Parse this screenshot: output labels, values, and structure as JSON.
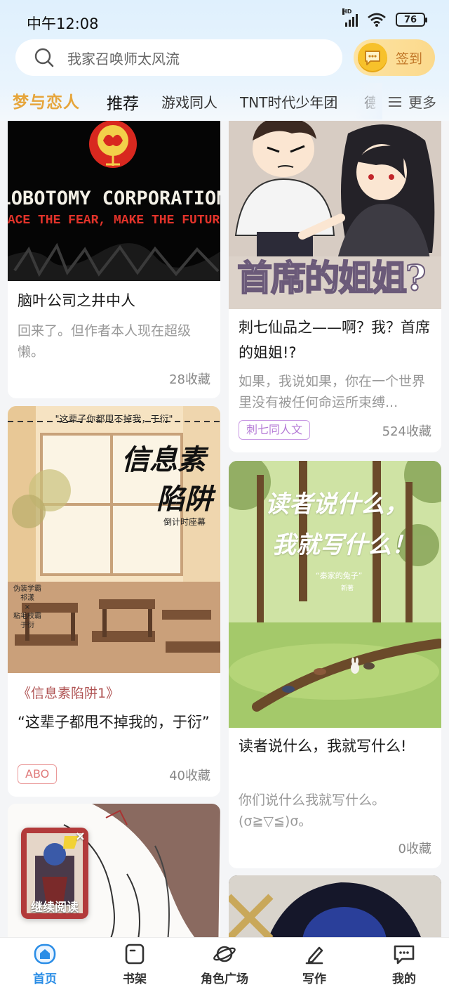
{
  "status_bar": {
    "time": "中午12:08",
    "battery": "76",
    "network": "HD"
  },
  "search": {
    "placeholder": "我家召唤师太风流"
  },
  "signin": {
    "label": "签到"
  },
  "tabs": [
    {
      "label": "梦与恋人"
    },
    {
      "label": "推荐"
    },
    {
      "label": "游戏同人"
    },
    {
      "label": "TNT时代少年团"
    },
    {
      "label": "德"
    }
  ],
  "more": {
    "label": "更多"
  },
  "cards": [
    {
      "cover_text_main": "LOBOTOMY CORPORATION",
      "cover_text_sub": "FACE THE FEAR, MAKE THE FUTURE",
      "title": "脑叶公司之井中人",
      "desc": "回来了。但作者本人现在超级懒。",
      "favorites": "28收藏"
    },
    {
      "cover_text": "首席的姐姐?",
      "title": "刺七仙品之——啊？我？首席的姐姐!?",
      "desc": "如果，我说如果，你在一个世界里没有被任何命运所束缚...",
      "tag": "刺七同人文",
      "favorites": "524收藏"
    },
    {
      "cover_text_top": "\"这辈子你都甩不掉我，于衍\"",
      "cover_text_main1": "信息素",
      "cover_text_main2": "陷阱",
      "cover_text_small": "倒计时座幕",
      "cover_text_left1": "伪装学霸",
      "cover_text_left2": "祁漾",
      "cover_text_left3": "×",
      "cover_text_left4": "粘毛校霸",
      "cover_text_left5": "于衍",
      "subtitle": "《信息素陷阱1》",
      "title": "“这辈子都甩不掉我的，于衍”",
      "tag": "ABO",
      "favorites": "40收藏"
    },
    {
      "cover_text1": "读者说什么，",
      "cover_text2": "我就写什么！",
      "cover_text_small": "“秦家的兔子”",
      "cover_text_tiny": "新著",
      "title": "读者说什么，我就写什么!",
      "desc": "你们说什么我就写什么。(σ≧▽≦)σ。",
      "favorites": "0收藏"
    }
  ],
  "continue_reading": {
    "label": "继续阅读",
    "close": "×"
  },
  "bottom_nav": [
    {
      "label": "首页",
      "active": true
    },
    {
      "label": "书架"
    },
    {
      "label": "角色广场"
    },
    {
      "label": "写作"
    },
    {
      "label": "我的"
    }
  ],
  "colors": {
    "accent": "#2a8de6",
    "fancy_tab": "#e6a53b",
    "tag_purple": "#b57bd6",
    "tag_red": "#e07a7a"
  }
}
